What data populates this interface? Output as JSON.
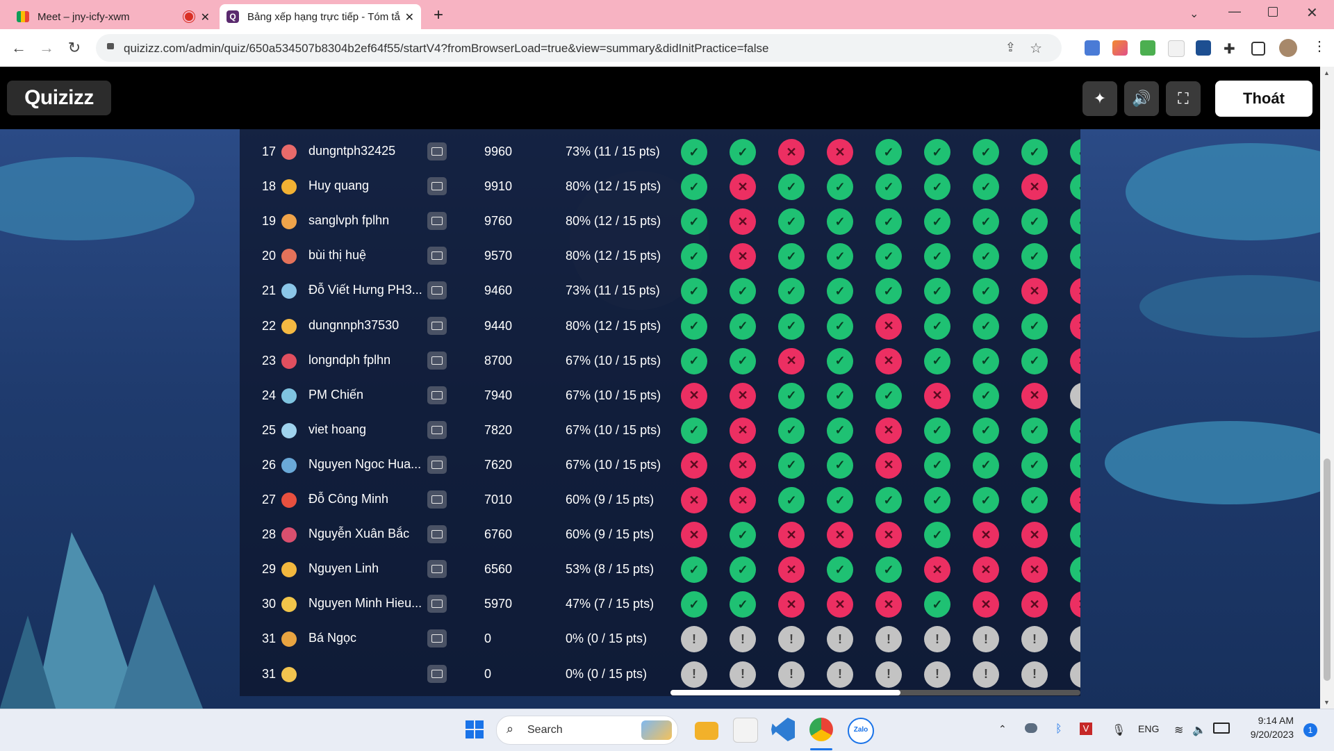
{
  "browser": {
    "tabs": [
      {
        "title": "Meet – jny-icfy-xwm",
        "recording": true
      },
      {
        "title": "Bảng xếp hạng trực tiếp - Tóm tắ",
        "active": true
      }
    ],
    "new_tab": "+",
    "url": "quizizz.com/admin/quiz/650a534507b8304b2ef64f55/startV4?fromBrowserLoad=true&view=summary&didInitPractice=false"
  },
  "header": {
    "logo": "Quizizz",
    "exit_label": "Thoát"
  },
  "leaderboard": {
    "rows": [
      {
        "rank": "17",
        "name": "dungntph32425",
        "score": "9960",
        "accuracy": "73% (11 / 15 pts)",
        "avatar_color": "#e86a6a",
        "answers": [
          "c",
          "c",
          "w",
          "w",
          "c",
          "c",
          "c",
          "c",
          "c"
        ]
      },
      {
        "rank": "18",
        "name": "Huy quang",
        "score": "9910",
        "accuracy": "80% (12 / 15 pts)",
        "avatar_color": "#f2b133",
        "answers": [
          "c",
          "w",
          "c",
          "c",
          "c",
          "c",
          "c",
          "w",
          "c"
        ]
      },
      {
        "rank": "19",
        "name": "sanglvph fplhn",
        "score": "9760",
        "accuracy": "80% (12 / 15 pts)",
        "avatar_color": "#f0a44a",
        "answers": [
          "c",
          "w",
          "c",
          "c",
          "c",
          "c",
          "c",
          "c",
          "c"
        ]
      },
      {
        "rank": "20",
        "name": "bùi thị huệ",
        "score": "9570",
        "accuracy": "80% (12 / 15 pts)",
        "avatar_color": "#e4725a",
        "answers": [
          "c",
          "w",
          "c",
          "c",
          "c",
          "c",
          "c",
          "c",
          "c"
        ]
      },
      {
        "rank": "21",
        "name": "Đỗ Viết Hưng PH3...",
        "score": "9460",
        "accuracy": "73% (11 / 15 pts)",
        "avatar_color": "#8bc6e8",
        "answers": [
          "c",
          "c",
          "c",
          "c",
          "c",
          "c",
          "c",
          "w",
          "w"
        ]
      },
      {
        "rank": "22",
        "name": "dungnnph37530",
        "score": "9440",
        "accuracy": "80% (12 / 15 pts)",
        "avatar_color": "#f5b942",
        "answers": [
          "c",
          "c",
          "c",
          "c",
          "w",
          "c",
          "c",
          "c",
          "w"
        ]
      },
      {
        "rank": "23",
        "name": "longndph fplhn",
        "score": "8700",
        "accuracy": "67% (10 / 15 pts)",
        "avatar_color": "#e04f5f",
        "answers": [
          "c",
          "c",
          "w",
          "c",
          "w",
          "c",
          "c",
          "c",
          "w"
        ]
      },
      {
        "rank": "24",
        "name": "PM Chiến",
        "score": "7940",
        "accuracy": "67% (10 / 15 pts)",
        "avatar_color": "#7fc4e0",
        "answers": [
          "w",
          "w",
          "c",
          "c",
          "c",
          "w",
          "c",
          "w",
          "u"
        ]
      },
      {
        "rank": "25",
        "name": "viet hoang",
        "score": "7820",
        "accuracy": "67% (10 / 15 pts)",
        "avatar_color": "#9fd3ee",
        "answers": [
          "c",
          "w",
          "c",
          "c",
          "w",
          "c",
          "c",
          "c",
          "c"
        ]
      },
      {
        "rank": "26",
        "name": "Nguyen Ngoc Hua...",
        "score": "7620",
        "accuracy": "67% (10 / 15 pts)",
        "avatar_color": "#6aa9d8",
        "answers": [
          "w",
          "w",
          "c",
          "c",
          "w",
          "c",
          "c",
          "c",
          "c"
        ]
      },
      {
        "rank": "27",
        "name": "Đỗ Công Minh",
        "score": "7010",
        "accuracy": "60% (9 / 15 pts)",
        "avatar_color": "#e8503f",
        "answers": [
          "w",
          "w",
          "c",
          "c",
          "c",
          "c",
          "c",
          "c",
          "w"
        ]
      },
      {
        "rank": "28",
        "name": "Nguyễn Xuân Bắc",
        "score": "6760",
        "accuracy": "60% (9 / 15 pts)",
        "avatar_color": "#d94f6e",
        "answers": [
          "w",
          "c",
          "w",
          "w",
          "w",
          "c",
          "w",
          "w",
          "c"
        ]
      },
      {
        "rank": "29",
        "name": "Nguyen Linh",
        "score": "6560",
        "accuracy": "53% (8 / 15 pts)",
        "avatar_color": "#f3b83e",
        "answers": [
          "c",
          "c",
          "w",
          "c",
          "c",
          "w",
          "w",
          "w",
          "c"
        ]
      },
      {
        "rank": "30",
        "name": "Nguyen Minh Hieu...",
        "score": "5970",
        "accuracy": "47% (7 / 15 pts)",
        "avatar_color": "#f2c54a",
        "answers": [
          "c",
          "c",
          "w",
          "w",
          "w",
          "c",
          "w",
          "w",
          "w"
        ]
      },
      {
        "rank": "31",
        "name": "Bá Ngọc",
        "score": "0",
        "accuracy": "0% (0 / 15 pts)",
        "avatar_color": "#e9a441",
        "answers": [
          "u",
          "u",
          "u",
          "u",
          "u",
          "u",
          "u",
          "u",
          "u"
        ]
      },
      {
        "rank": "31",
        "name": "",
        "score": "0",
        "accuracy": "0% (0 / 15 pts)",
        "avatar_color": "#f2c44f",
        "answers": [
          "u",
          "u",
          "u",
          "u",
          "u",
          "u",
          "u",
          "u",
          "u"
        ]
      }
    ],
    "answer_glyphs": {
      "c": "✓",
      "w": "✕",
      "u": "!"
    }
  },
  "taskbar": {
    "search_placeholder": "Search",
    "language": "ENG",
    "time": "9:14 AM",
    "date": "9/20/2023",
    "notification_count": "1"
  }
}
